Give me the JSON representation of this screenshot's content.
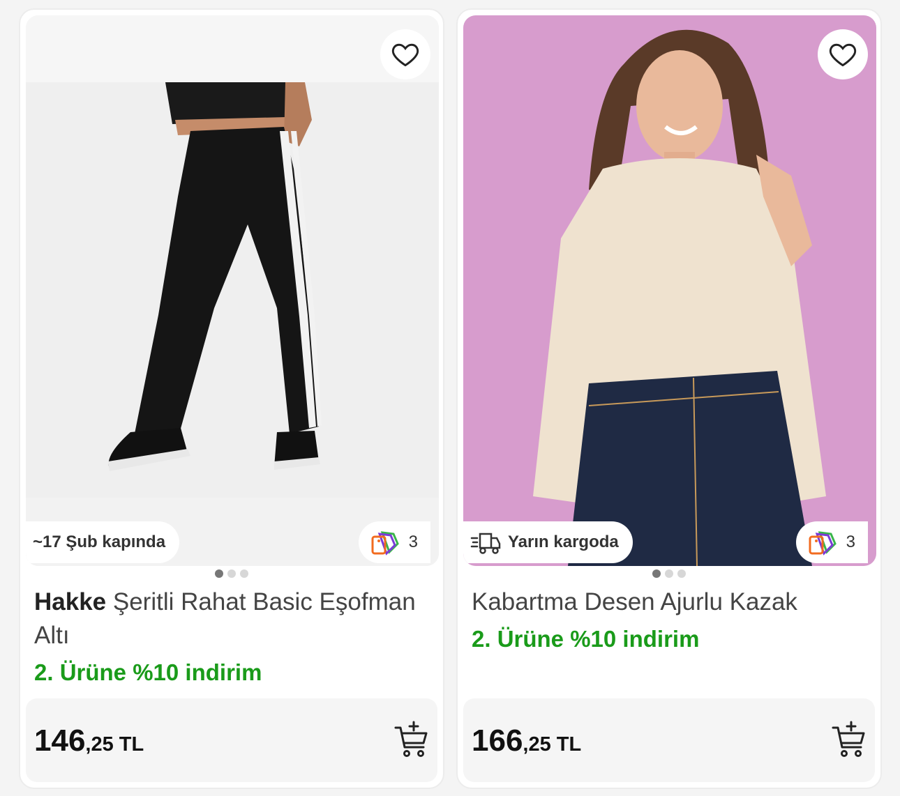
{
  "products": [
    {
      "brand": "Hakke",
      "name": "Şeritli Rahat Basic Eşofman Altı",
      "delivery": "~17 Şub kapında",
      "promo_count": "3",
      "offer": "2. Ürüne %10 indirim",
      "price_int": "146",
      "price_dec": ",25 TL",
      "icons": {
        "favorite": "heart-icon",
        "cart": "add-to-cart-icon",
        "promo": "price-tags-icon"
      }
    },
    {
      "brand": "",
      "name": "Kabartma Desen Ajurlu Kazak",
      "delivery": "Yarın kargoda",
      "promo_count": "3",
      "offer": "2. Ürüne %10 indirim",
      "price_int": "166",
      "price_dec": ",25 TL",
      "icons": {
        "favorite": "heart-icon",
        "cart": "add-to-cart-icon",
        "promo": "price-tags-icon",
        "delivery": "fast-delivery-truck-icon"
      }
    }
  ],
  "colors": {
    "offer": "#1a9b1a",
    "pink_bg": "#d79ccd",
    "promo_orange": "#f26b1f",
    "promo_purple": "#7a3bd6",
    "promo_green": "#39b54a"
  }
}
